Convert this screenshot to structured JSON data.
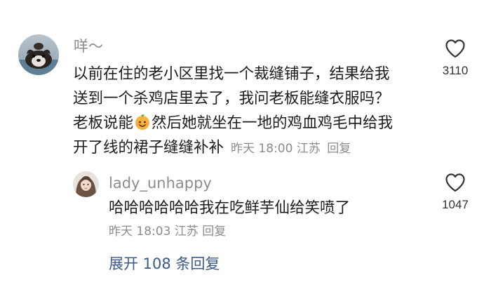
{
  "comment": {
    "username": "咩～",
    "lines": [
      "以前在住的老小区里找一个裁缝铺子，结果给我",
      "送到一个杀鸡店里去了，我问老板能缝衣服吗？",
      "老板说能",
      "然后她就坐在一地的鸡血鸡毛中给我",
      "开了线的裙子缝缝补补"
    ],
    "emoji": "orange-smile-emoji",
    "time": "昨天 18:00",
    "location": "江苏",
    "reply_label": "回复",
    "like_count": "3110"
  },
  "reply": {
    "username": "lady_unhappy",
    "text": "哈哈哈哈哈哈我在吃鲜芋仙给笑喷了",
    "time": "昨天 18:03",
    "location": "江苏",
    "reply_label": "回复",
    "like_count": "1047"
  },
  "expand": {
    "label": "展开 108 条回复"
  },
  "colors": {
    "meta_gray": "#8c8c8c",
    "link_blue": "#3a5b8c",
    "text": "#1c1c1c"
  }
}
